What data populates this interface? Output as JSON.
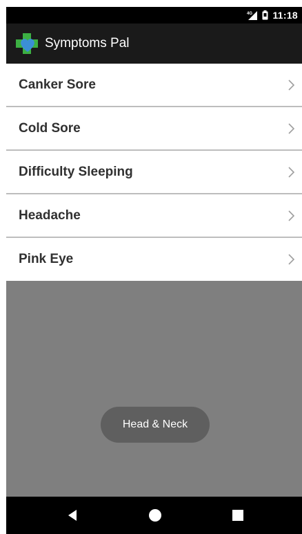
{
  "status_bar": {
    "network_label": "4G",
    "time": "11:18",
    "icons": [
      "signal-icon",
      "battery-icon"
    ]
  },
  "app_bar": {
    "title": "Symptoms Pal",
    "logo_icon": "heart-cross-logo",
    "colors": {
      "cross": "#3cb043",
      "heart": "#3b8fd6"
    }
  },
  "symptoms": [
    {
      "label": "Canker Sore",
      "icon": "chevron-right-icon"
    },
    {
      "label": "Cold Sore",
      "icon": "chevron-right-icon"
    },
    {
      "label": "Difficulty Sleeping",
      "icon": "chevron-right-icon"
    },
    {
      "label": "Headache",
      "icon": "chevron-right-icon"
    },
    {
      "label": "Pink Eye",
      "icon": "chevron-right-icon"
    }
  ],
  "toast": {
    "text": "Head & Neck"
  },
  "nav_bar": {
    "buttons": [
      "back-icon",
      "home-icon",
      "recents-icon"
    ]
  },
  "colors": {
    "status_bar": "#000000",
    "app_bar": "#1a1a1a",
    "list_background": "#ffffff",
    "divider": "#bdbdbd",
    "scrim": "#7f7f7f",
    "toast": "#5f5f5f"
  }
}
